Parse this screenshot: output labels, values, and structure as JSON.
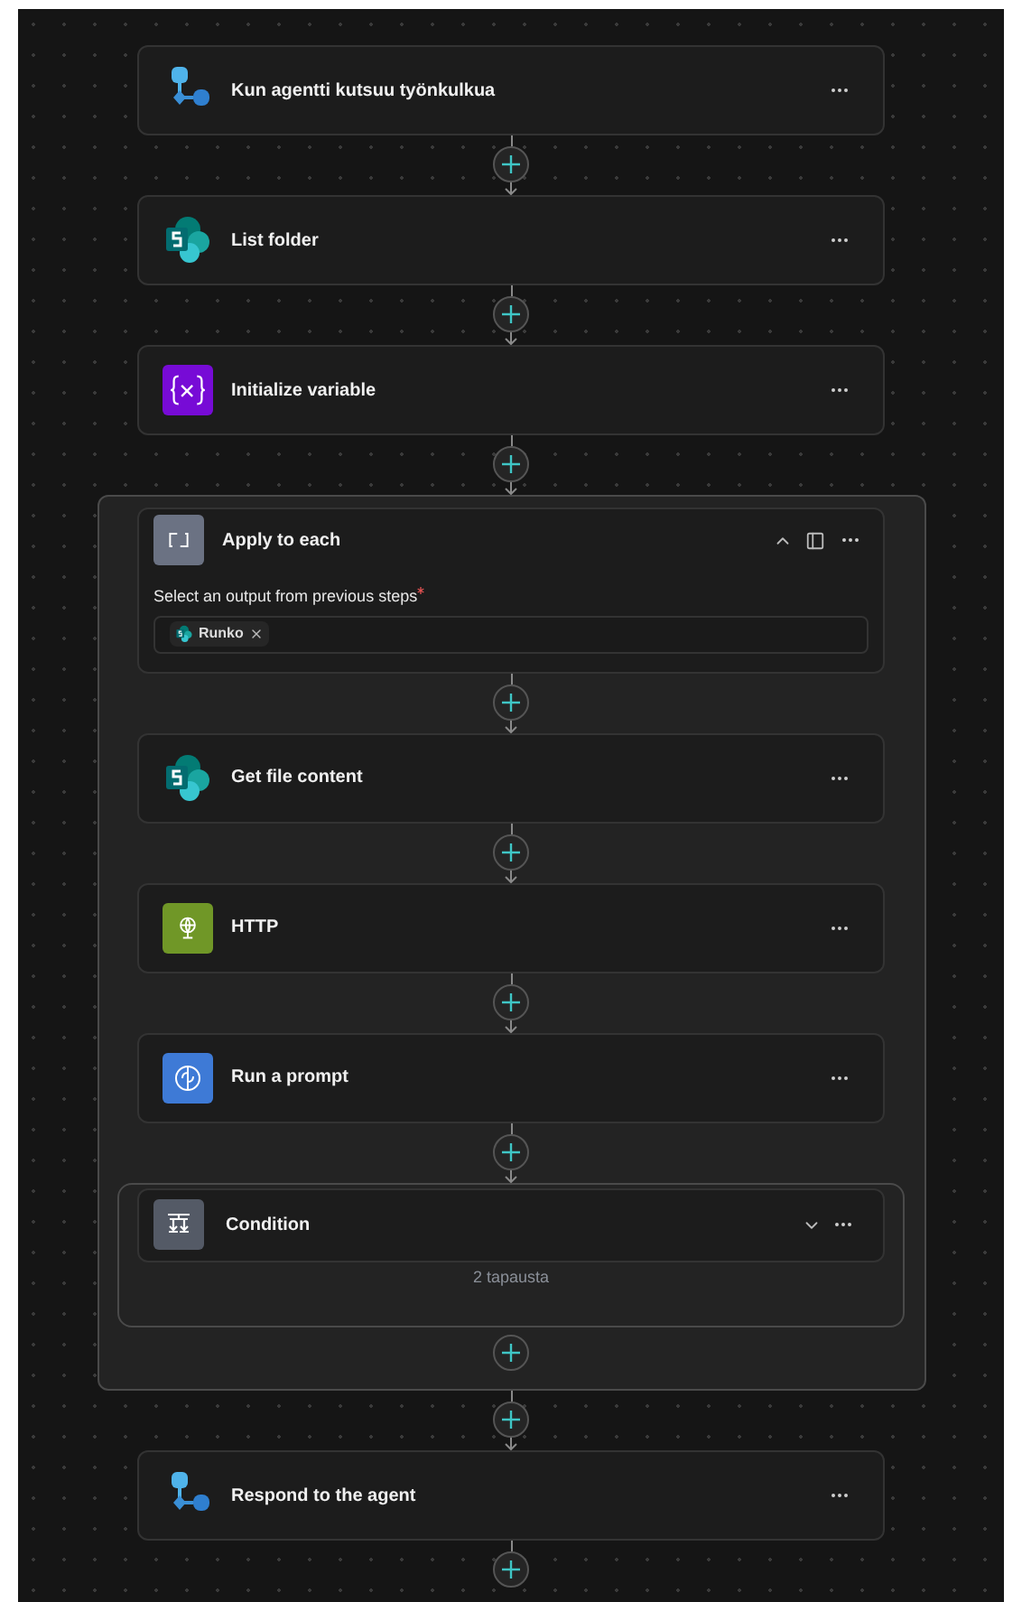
{
  "steps": [
    {
      "kind": "trigger",
      "title": "Kun agentti kutsuu työnkulkua"
    },
    {
      "kind": "sharepoint",
      "title": "List folder"
    },
    {
      "kind": "variable",
      "title": "Initialize variable"
    },
    {
      "kind": "loop",
      "title": "Apply to each",
      "expanded": true,
      "field": {
        "label": "Select an output from previous steps",
        "required": true,
        "token": "Runko"
      },
      "children": [
        {
          "kind": "sharepoint",
          "title": "Get file content"
        },
        {
          "kind": "http",
          "title": "HTTP"
        },
        {
          "kind": "prompt",
          "title": "Run a prompt"
        },
        {
          "kind": "condition",
          "title": "Condition",
          "expanded": false,
          "summary": "2 tapausta"
        }
      ]
    },
    {
      "kind": "trigger",
      "title": "Respond to the agent"
    }
  ]
}
